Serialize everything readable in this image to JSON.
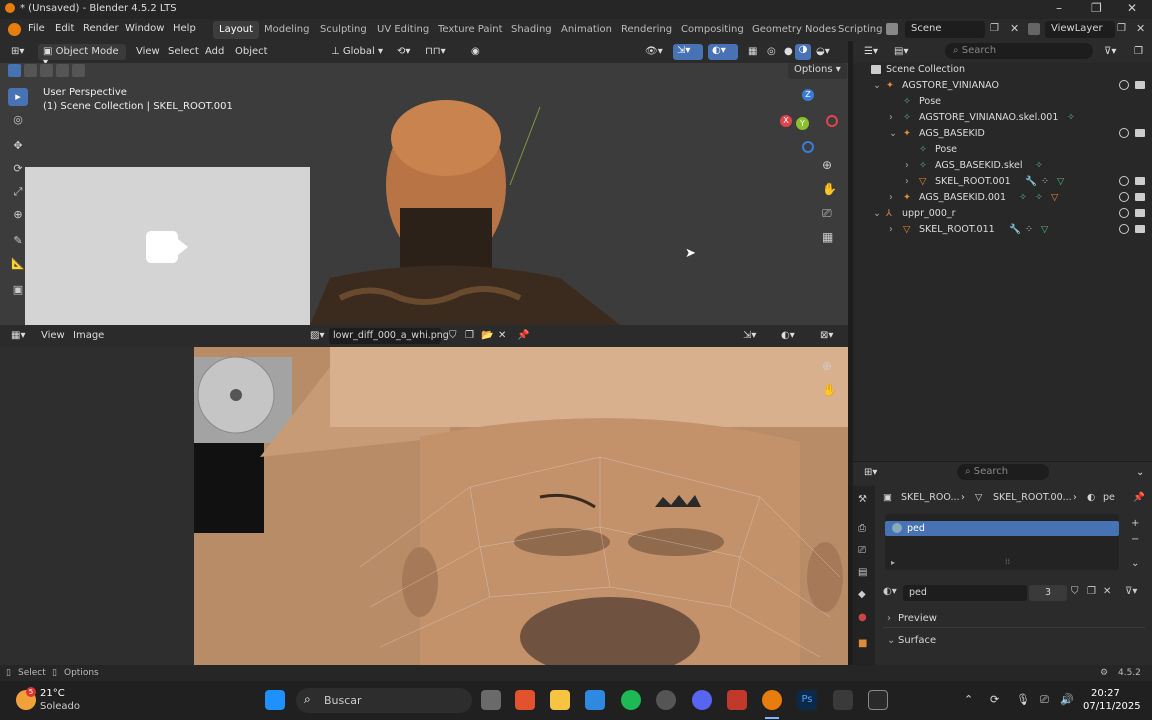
{
  "window": {
    "title": "* (Unsaved) - Blender 4.5.2 LTS"
  },
  "menu": {
    "file": "File",
    "edit": "Edit",
    "render": "Render",
    "window": "Window",
    "help": "Help"
  },
  "workspaces": [
    "Layout",
    "Modeling",
    "Sculpting",
    "UV Editing",
    "Texture Paint",
    "Shading",
    "Animation",
    "Rendering",
    "Compositing",
    "Geometry Nodes",
    "Scripting"
  ],
  "scene": {
    "name": "Scene",
    "view_layer": "ViewLayer"
  },
  "viewport": {
    "mode": "Object Mode",
    "menu": {
      "view": "View",
      "select": "Select",
      "add": "Add",
      "object": "Object"
    },
    "orientation": "Global",
    "options": "Options",
    "perspective": "User Perspective",
    "collection_info": "(1) Scene Collection | SKEL_ROOT.001",
    "gizmo": {
      "z": "Z",
      "y": "Y",
      "x": "X"
    }
  },
  "image_editor": {
    "menu": {
      "view": "View",
      "image": "Image"
    },
    "image_name": "lowr_diff_000_a_whi.png"
  },
  "outliner": {
    "search_placeholder": "Search",
    "root": "Scene Collection",
    "rows": [
      {
        "label": "AGSTORE_VINIANAO"
      },
      {
        "label": "Pose"
      },
      {
        "label": "AGSTORE_VINIANAO.skel.001"
      },
      {
        "label": "AGS_BASEKID"
      },
      {
        "label": "Pose"
      },
      {
        "label": "AGS_BASEKID.skel"
      },
      {
        "label": "SKEL_ROOT.001"
      },
      {
        "label": "AGS_BASEKID.001"
      },
      {
        "label": "uppr_000_r"
      },
      {
        "label": "SKEL_ROOT.011"
      }
    ]
  },
  "properties": {
    "search_placeholder": "Search",
    "breadcrumb": [
      "SKEL_ROO...",
      "SKEL_ROOT.00...",
      "pe"
    ],
    "material_slot": "ped",
    "material_name": "ped",
    "user_count": "3",
    "panels": {
      "preview": "Preview",
      "surface": "Surface"
    }
  },
  "statusbar": {
    "select": "Select",
    "options": "Options",
    "version": "4.5.2"
  },
  "taskbar": {
    "temp": "21°C",
    "weather": "Soleado",
    "badge": "5",
    "search": "Buscar",
    "time": "20:27",
    "date": "07/11/2025"
  },
  "colors": {
    "accent": "#4772b3",
    "active_ws": "#3d3d3d",
    "outliner_bg": "#282828"
  }
}
